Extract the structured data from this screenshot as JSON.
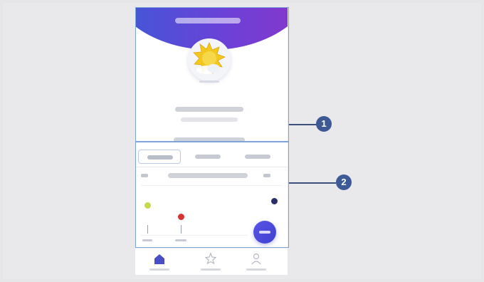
{
  "callouts": [
    {
      "number": "1"
    },
    {
      "number": "2"
    }
  ],
  "colors": {
    "header_gradient": [
      "#3b5bd6",
      "#8b34c9"
    ],
    "callout": "#3d5a96",
    "panel_outline": "#7ea3d8",
    "fab": "#4a48dc",
    "dot_yellow": "#c8d84a",
    "dot_red": "#d9332f",
    "dot_navy": "#2a2f6a",
    "nav_active": "#4a4fc8"
  },
  "icons": {
    "avatar": "sun-cloud-icon",
    "nav": [
      "home-icon",
      "star-icon",
      "person-icon"
    ],
    "fab": "add-icon"
  }
}
